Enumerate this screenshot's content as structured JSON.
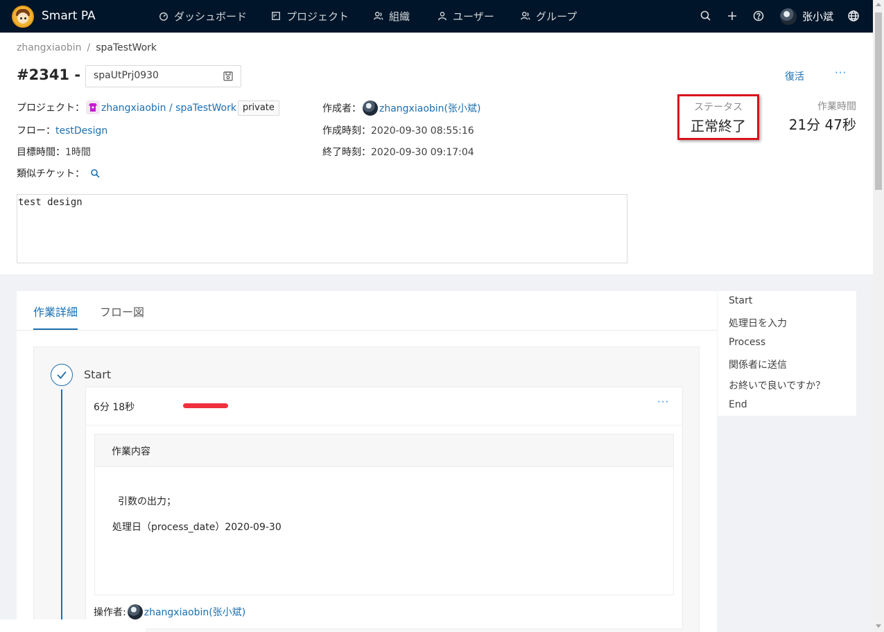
{
  "app": {
    "brand": "Smart PA"
  },
  "nav": {
    "items": [
      {
        "label": "ダッシュボード",
        "icon": "dashboard-icon"
      },
      {
        "label": "プロジェクト",
        "icon": "project-icon"
      },
      {
        "label": "組織",
        "icon": "organization-icon"
      },
      {
        "label": "ユーザー",
        "icon": "user-icon"
      },
      {
        "label": "グループ",
        "icon": "group-icon"
      }
    ],
    "user_name": "张小斌"
  },
  "breadcrumb": {
    "owner": "zhangxiaobin",
    "separator": "/",
    "project": "spaTestWork"
  },
  "ticket": {
    "number": "#2341 -",
    "title_value": "spaUtPrj0930",
    "restore_label": "復活",
    "more_label": "···"
  },
  "meta": {
    "project_label": "プロジェクト：",
    "project_value": "zhangxiaobin / spaTestWork",
    "visibility": "private",
    "flow_label": "フロー：",
    "flow_value": "testDesign",
    "target_time_label": "目標時間：",
    "target_time_value": "1時間",
    "similar_label": "類似チケット：",
    "creator_label": "作成者：",
    "creator_value": "zhangxiaobin(张小斌)",
    "created_label": "作成時刻：",
    "created_value": "2020-09-30 08:55:16",
    "ended_label": "終了時刻：",
    "ended_value": "2020-09-30 09:17:04"
  },
  "description": "test design",
  "status": {
    "label": "ステータス",
    "value": "正常終了",
    "work_time_label": "作業時間",
    "work_time_value": "21分 47秒",
    "highlight_color": "#d9121c"
  },
  "tabs": [
    {
      "label": "作業詳細",
      "active": true
    },
    {
      "label": "フロー図",
      "active": false
    }
  ],
  "step": {
    "title": "Start",
    "duration": "6分 18秒",
    "more_label": "···",
    "content_header": "作業内容",
    "content_line1": "引数の出力；",
    "content_line2": "処理日（process_date）2020-09-30",
    "operator_label": "操作者:",
    "operator_value": "zhangxiaobin(张小斌)"
  },
  "anchors": [
    "Start",
    "処理日を入力",
    "Process",
    "関係者に送信",
    "お終いで良いですか？",
    "End"
  ],
  "colors": {
    "nav_bg": "#001529",
    "link": "#1a6fb0",
    "accent_red": "#f0303f"
  }
}
